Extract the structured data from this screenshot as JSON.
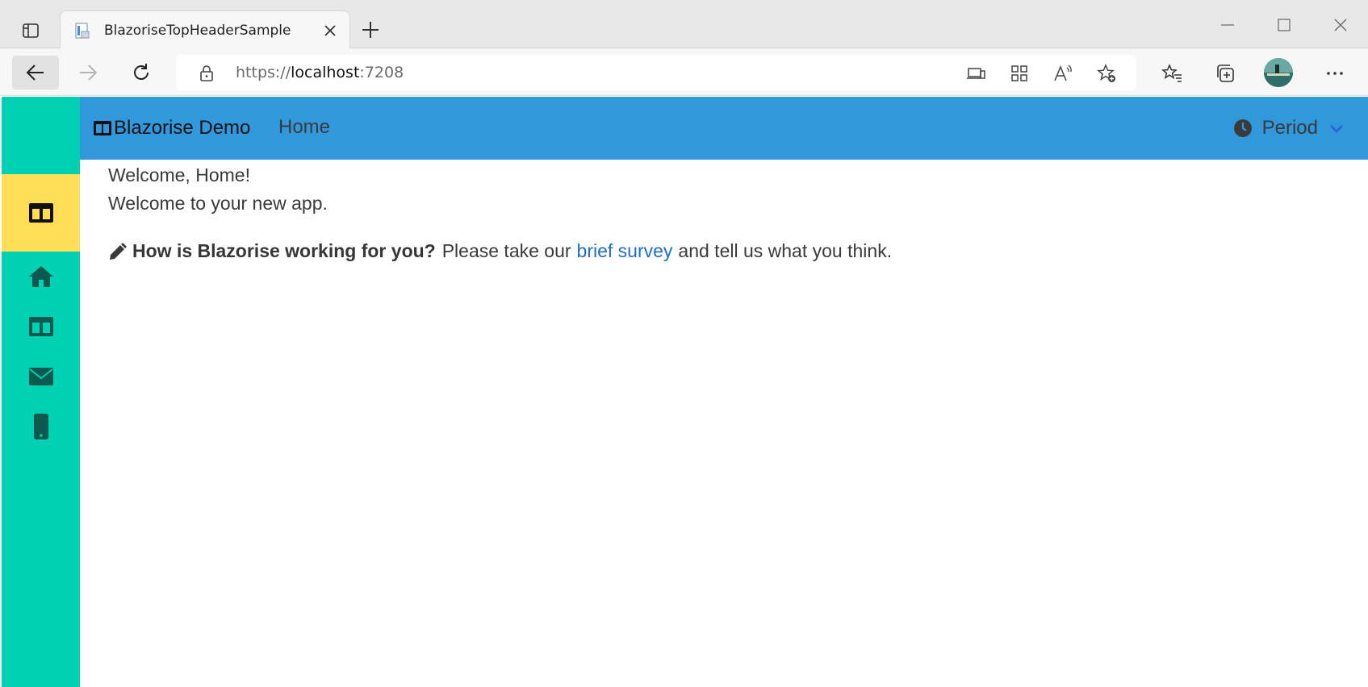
{
  "browser": {
    "tab": {
      "title": "BlazoriseTopHeaderSample"
    },
    "address": {
      "scheme": "https://",
      "host": "localhost",
      "port": ":7208"
    },
    "icons": [
      "tab-actions-icon",
      "page-favicon",
      "close-icon",
      "plus-icon",
      "minimize-icon",
      "maximize-icon",
      "close-window-icon",
      "back-arrow-icon",
      "forward-arrow-icon",
      "reload-icon",
      "lock-icon",
      "device-icon",
      "app-grid-icon",
      "read-aloud-icon",
      "add-favorite-icon",
      "favorites-icon",
      "collections-icon",
      "avatar",
      "more-icon"
    ]
  },
  "app": {
    "colors": {
      "sidebar": "#00d1b2",
      "sidebar_active": "#ffdd57",
      "header": "#3298dc",
      "link": "#1e6fc5"
    },
    "header": {
      "brand": "Blazorise Demo",
      "nav_home": "Home",
      "period": "Period"
    },
    "sidebar": {
      "items": [
        {
          "icon": "table-columns-icon",
          "active": true
        },
        {
          "icon": "home-icon"
        },
        {
          "icon": "table-columns-icon"
        },
        {
          "icon": "envelope-icon"
        },
        {
          "icon": "mobile-icon"
        }
      ]
    },
    "content": {
      "welcome_title": "Welcome, Home!",
      "welcome_text": "Welcome to your new app.",
      "survey": {
        "question": "How is Blazorise working for you?",
        "prefix": "Please take our",
        "link": "brief survey",
        "suffix": "and tell us what you think."
      }
    }
  }
}
